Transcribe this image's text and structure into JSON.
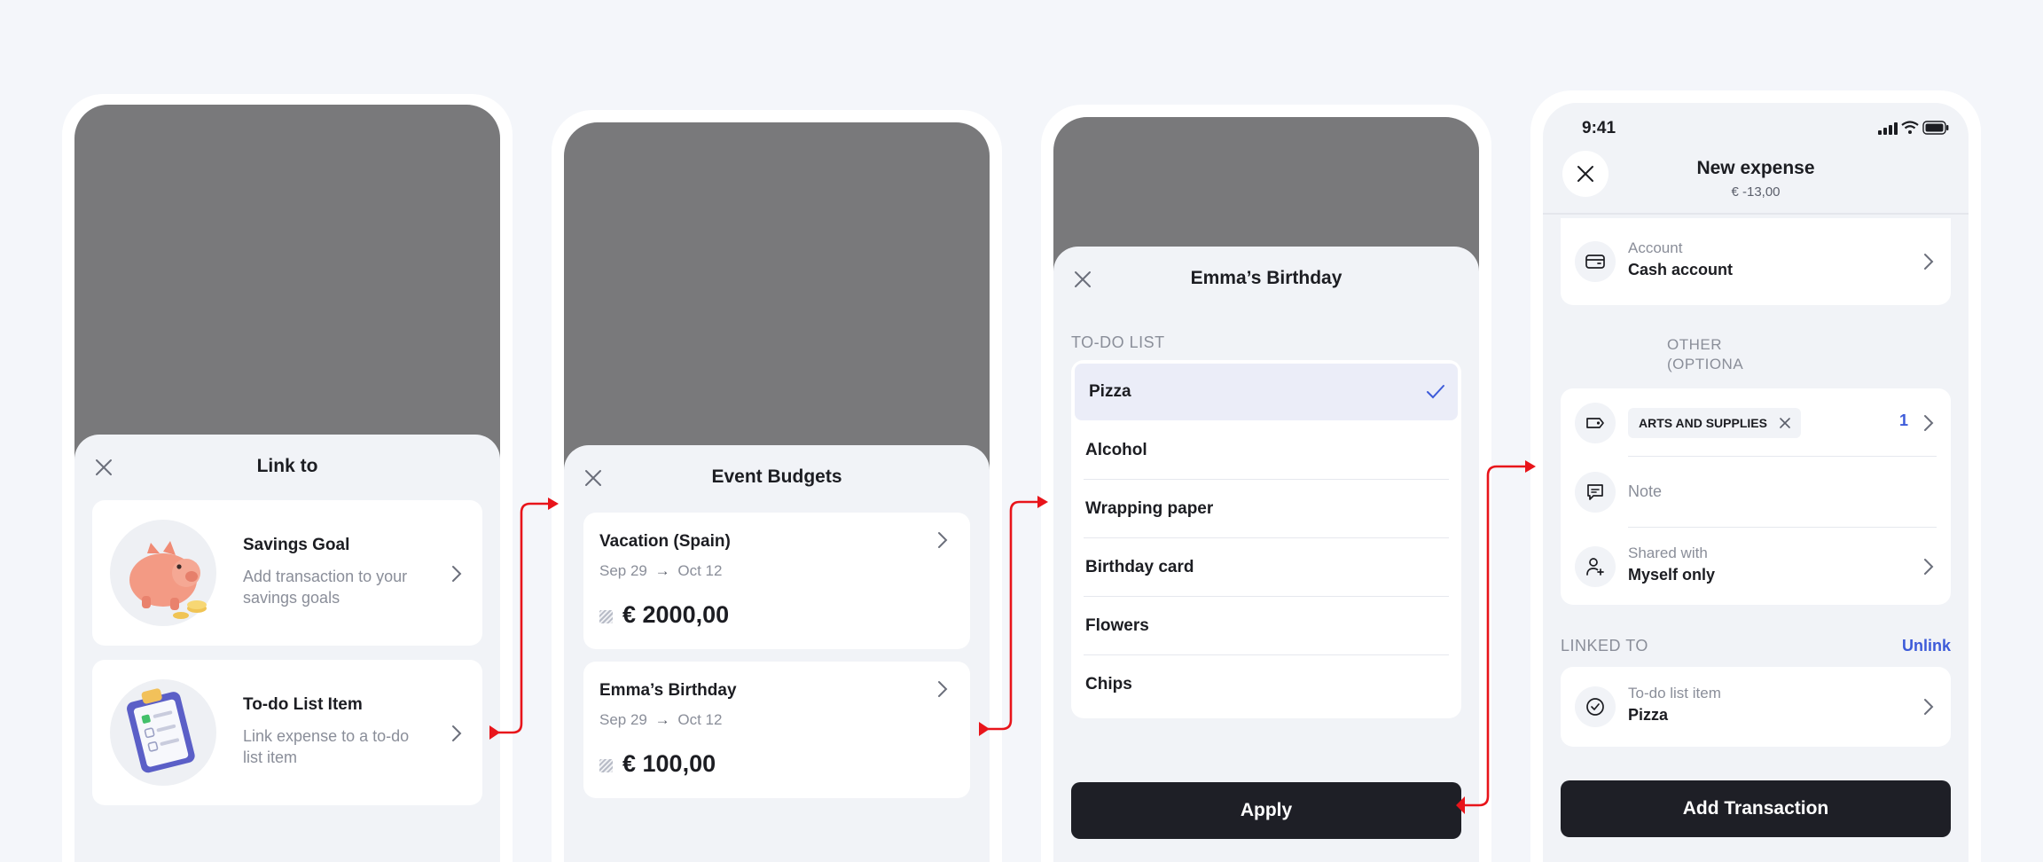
{
  "screen1": {
    "title": "Link to",
    "items": [
      {
        "title": "Savings Goal",
        "desc": "Add transaction to your savings goals",
        "icon": "piggy-bank-icon"
      },
      {
        "title": "To-do List Item",
        "desc": "Link expense to a to-do list item",
        "icon": "clipboard-icon"
      }
    ]
  },
  "screen2": {
    "title": "Event Budgets",
    "budgets": [
      {
        "name": "Vacation (Spain)",
        "start": "Sep 29",
        "end": "Oct 12",
        "amount": "€ 2000,00"
      },
      {
        "name": "Emma’s Birthday",
        "start": "Sep 29",
        "end": "Oct 12",
        "amount": "€ 100,00"
      }
    ]
  },
  "screen3": {
    "title": "Emma’s Birthday",
    "section": "TO-DO LIST",
    "items": [
      "Pizza",
      "Alcohol",
      "Wrapping paper",
      "Birthday card",
      "Flowers",
      "Chips"
    ],
    "selected": "Pizza",
    "apply": "Apply"
  },
  "screen4": {
    "status_time": "9:41",
    "title": "New expense",
    "amount": "€ -13,00",
    "account_label": "Account",
    "account_value": "Cash account",
    "other_label": "OTHER (OPTIONAL)",
    "tag": "ARTS AND SUPPLIES",
    "tag_count": "1",
    "note_placeholder": "Note",
    "shared_label": "Shared with",
    "shared_value": "Myself only",
    "linked_label": "LINKED TO",
    "unlink": "Unlink",
    "linked_sub": "To-do list item",
    "linked_value": "Pizza",
    "add_button": "Add Transaction"
  },
  "colors": {
    "accent": "#3d5bd9",
    "dark": "#1e1f26",
    "arrow": "#e8141a",
    "overlay": "#79797b",
    "selected_row": "#ebedf8"
  }
}
